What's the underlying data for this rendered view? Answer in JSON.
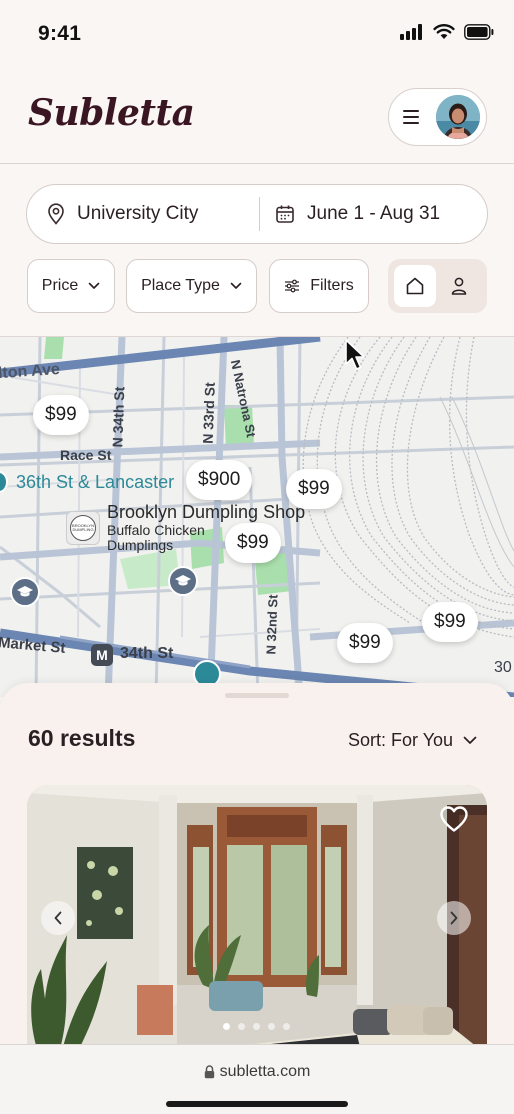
{
  "status_bar": {
    "time": "9:41"
  },
  "header": {
    "logo": "Subletta"
  },
  "search": {
    "location": "University City",
    "dates": "June 1 - Aug 31"
  },
  "filters": {
    "price": "Price",
    "place_type": "Place Type",
    "filters": "Filters"
  },
  "map": {
    "streets": {
      "hilton_ave": "lton Ave",
      "race_st": "Race St",
      "n34th": "N 34th St",
      "n33rd": "N 33rd St",
      "natrona": "N Natrona St",
      "n32nd": "N 32nd St",
      "market": "Market St",
      "th34": "34th St",
      "edge": "30"
    },
    "transit": "36th St & Lancaster",
    "place_name": "Brooklyn Dumpling Shop",
    "place_sub": "Buffalo Chicken\nDumplings",
    "place_logo_text": "BROOKLYN DUMPLING",
    "metro_letter": "M",
    "prices": [
      "$99",
      "$900",
      "$99",
      "$99",
      "$99",
      "$99"
    ]
  },
  "sheet": {
    "results": "60 results",
    "sort": "Sort: For You"
  },
  "browser": {
    "url": "subletta.com"
  },
  "colors": {
    "brand": "#3a1622",
    "transit": "#2c8a98",
    "park": "#a9dfac",
    "road_major": "#6b86b2"
  }
}
